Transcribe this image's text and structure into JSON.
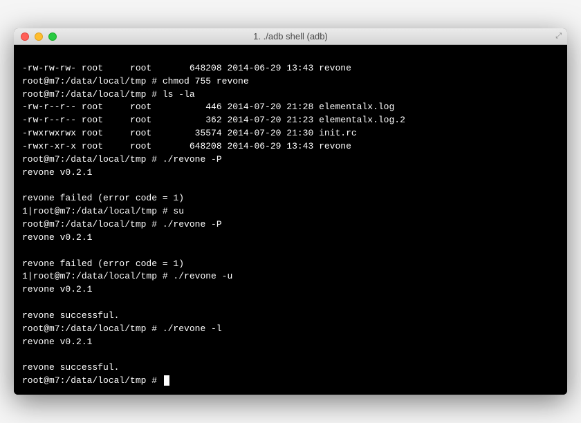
{
  "window": {
    "title": "1. ./adb shell (adb)"
  },
  "terminal": {
    "lines": [
      "-rw-rw-rw- root     root       648208 2014-06-29 13:43 revone",
      "root@m7:/data/local/tmp # chmod 755 revone",
      "root@m7:/data/local/tmp # ls -la",
      "-rw-r--r-- root     root          446 2014-07-20 21:28 elementalx.log",
      "-rw-r--r-- root     root          362 2014-07-20 21:23 elementalx.log.2",
      "-rwxrwxrwx root     root        35574 2014-07-20 21:30 init.rc",
      "-rwxr-xr-x root     root       648208 2014-06-29 13:43 revone",
      "root@m7:/data/local/tmp # ./revone -P",
      "revone v0.2.1",
      "",
      "revone failed (error code = 1)",
      "1|root@m7:/data/local/tmp # su",
      "root@m7:/data/local/tmp # ./revone -P",
      "revone v0.2.1",
      "",
      "revone failed (error code = 1)",
      "1|root@m7:/data/local/tmp # ./revone -u",
      "revone v0.2.1",
      "",
      "revone successful.",
      "root@m7:/data/local/tmp # ./revone -l",
      "revone v0.2.1",
      "",
      "revone successful.",
      "root@m7:/data/local/tmp # "
    ]
  }
}
